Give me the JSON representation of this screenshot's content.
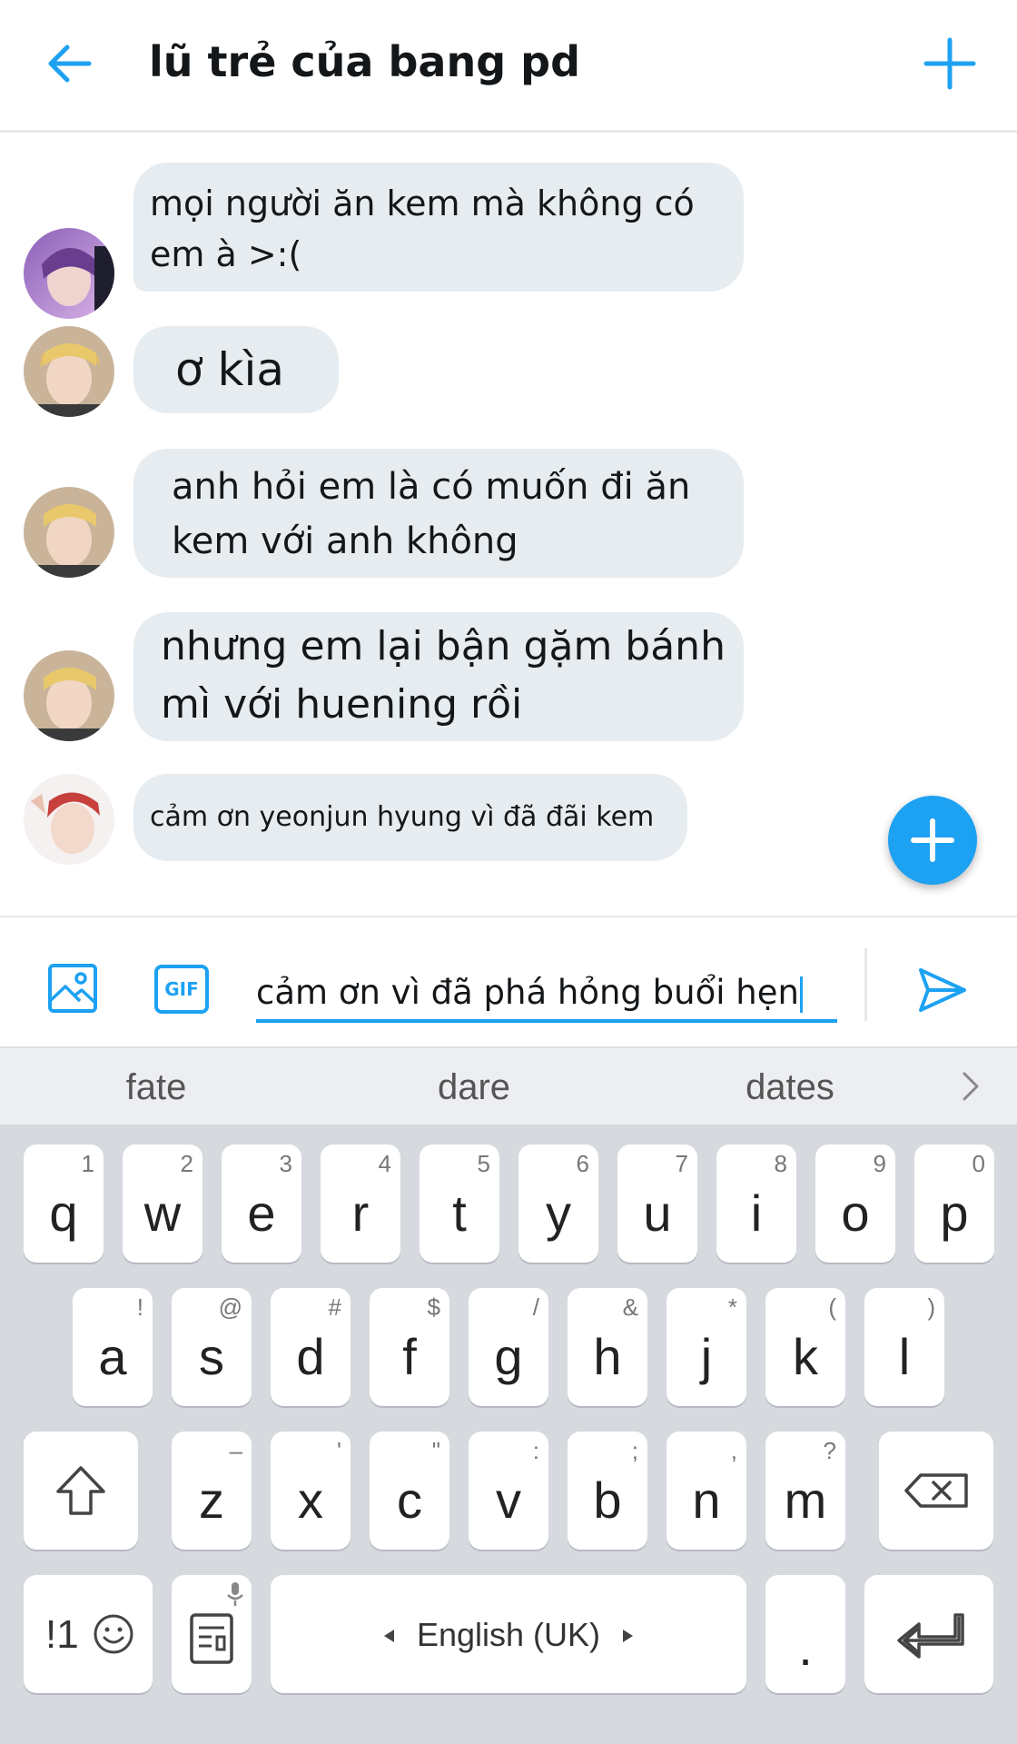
{
  "header": {
    "title": "lũ trẻ của bang pd"
  },
  "messages": [
    {
      "lines": [
        "mọi người ăn kem mà không có",
        "em à >:("
      ]
    },
    {
      "lines": [
        "ơ kìa"
      ]
    },
    {
      "lines": [
        "anh hỏi em là có muốn đi ăn",
        "kem với anh không"
      ]
    },
    {
      "lines": [
        "nhưng em lại bận gặm bánh",
        "mì với huening rồi"
      ]
    },
    {
      "lines": [
        "cảm ơn yeonjun hyung vì đã đãi kem"
      ]
    }
  ],
  "composer": {
    "gif_label": "GIF",
    "value": "cảm ơn vì đã phá hỏng buổi hẹn"
  },
  "keyboard": {
    "suggestions": [
      "fate",
      "dare",
      "dates"
    ],
    "row1": [
      {
        "k": "q",
        "h": "1"
      },
      {
        "k": "w",
        "h": "2"
      },
      {
        "k": "e",
        "h": "3"
      },
      {
        "k": "r",
        "h": "4"
      },
      {
        "k": "t",
        "h": "5"
      },
      {
        "k": "y",
        "h": "6"
      },
      {
        "k": "u",
        "h": "7"
      },
      {
        "k": "i",
        "h": "8"
      },
      {
        "k": "o",
        "h": "9"
      },
      {
        "k": "p",
        "h": "0"
      }
    ],
    "row2": [
      {
        "k": "a",
        "h": "!"
      },
      {
        "k": "s",
        "h": "@"
      },
      {
        "k": "d",
        "h": "#"
      },
      {
        "k": "f",
        "h": "$"
      },
      {
        "k": "g",
        "h": "/"
      },
      {
        "k": "h",
        "h": "&"
      },
      {
        "k": "j",
        "h": "*"
      },
      {
        "k": "k",
        "h": "("
      },
      {
        "k": "l",
        "h": ")"
      }
    ],
    "row3": [
      {
        "k": "z",
        "h": "–"
      },
      {
        "k": "x",
        "h": "'"
      },
      {
        "k": "c",
        "h": "\""
      },
      {
        "k": "v",
        "h": ":"
      },
      {
        "k": "b",
        "h": ";"
      },
      {
        "k": "n",
        "h": ","
      },
      {
        "k": "m",
        "h": "?"
      }
    ],
    "symbols_label": "!1",
    "space_label": "English (UK)",
    "period_label": "."
  },
  "colors": {
    "accent": "#1da1f2",
    "bubble": "#e6ecf0",
    "keyboard_bg": "#d6d9de"
  }
}
